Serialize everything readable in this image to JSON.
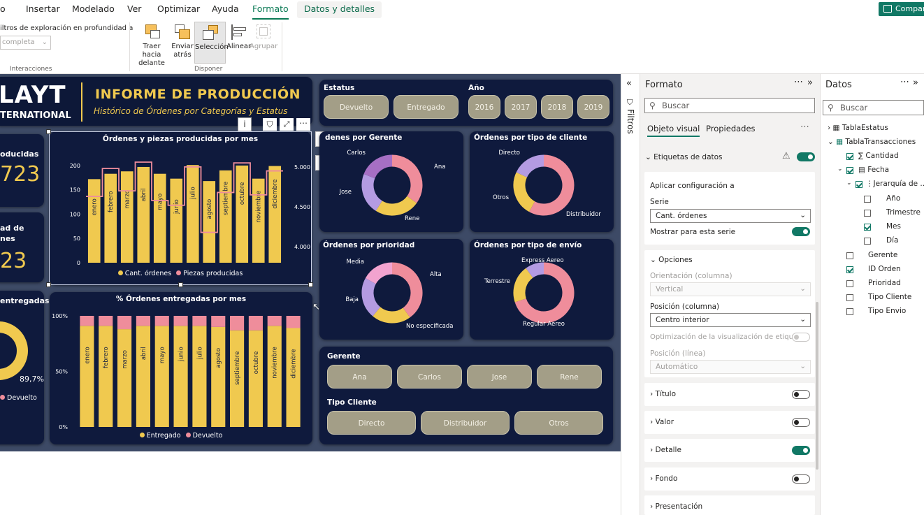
{
  "ribbon": {
    "tabs": [
      "o",
      "Insertar",
      "Modelado",
      "Ver",
      "Optimizar",
      "Ayuda",
      "Formato",
      "Datos y detalles"
    ],
    "share": "Compart",
    "drill_label": "iltros de exploración en profundidad a",
    "drill_value": "completa",
    "group_interacciones": "Interacciones",
    "group_disponer": "Disponer",
    "buttons": [
      "Traer hacia delante",
      "Enviar atrás",
      "Selección",
      "Alinear",
      "Agrupar"
    ]
  },
  "report": {
    "logo": "LAYT",
    "logo_sub": "TERNATIONAL",
    "title": "INFORME DE PRODUCCIÓN",
    "subtitle": "Histórico de Órdenes por Categorías y Estatus",
    "kpi1_label": "oducidas",
    "kpi1_value": "723",
    "kpi2_label": "ad de",
    "kpi2_label2": "nes",
    "kpi2_value": "23",
    "kpi3_label": "entregadas",
    "kpi3_value": "89,7%",
    "kpi3_legend": "Devuelto",
    "estatus_label": "Estatus",
    "estatus_options": [
      "Devuelto",
      "Entregado"
    ],
    "anio_label": "Año",
    "anio_options": [
      "2016",
      "2017",
      "2018",
      "2019"
    ],
    "gerente_label": "Gerente",
    "gerente_options": [
      "Ana",
      "Carlos",
      "Jose",
      "Rene"
    ],
    "tipo_cliente_label": "Tipo Cliente",
    "tipo_cliente_options": [
      "Directo",
      "Distribuidor",
      "Otros"
    ]
  },
  "charts": {
    "combo_title": "Órdenes y piezas producidas por mes",
    "combo_legend": [
      "Cant. órdenes",
      "Piezas producidas"
    ],
    "pct_title": "% Órdenes entregadas por mes",
    "pct_legend": [
      "Entregado",
      "Devuelto"
    ],
    "donut_gerente_title": "denes por Gerente",
    "donut_cliente_title": "Órdenes por tipo de cliente",
    "donut_prioridad_title": "Órdenes por prioridad",
    "donut_envio_title": "Órdenes por tipo de envío"
  },
  "chart_data": [
    {
      "type": "bar",
      "title": "Órdenes y piezas producidas por mes",
      "categories": [
        "enero",
        "febrero",
        "marzo",
        "abril",
        "mayo",
        "junio",
        "julio",
        "agosto",
        "septiembre",
        "octubre",
        "noviembre",
        "diciembre"
      ],
      "series": [
        {
          "name": "Cant. órdenes",
          "values": [
            172,
            183,
            188,
            197,
            183,
            173,
            201,
            168,
            190,
            200,
            173,
            199
          ]
        },
        {
          "name": "Piezas producidas",
          "values": [
            4630,
            4980,
            4700,
            5060,
            4580,
            4520,
            5000,
            4180,
            4680,
            5050,
            4650,
            4950
          ]
        }
      ],
      "yticks": [
        "0",
        "50",
        "100",
        "150",
        "200"
      ],
      "ylim": [
        0,
        230
      ],
      "y2ticks": [
        "4.000",
        "4.500",
        "5.000"
      ],
      "y2lim": [
        3800,
        5200
      ]
    },
    {
      "type": "bar",
      "title": "% Órdenes entregadas por mes",
      "categories": [
        "enero",
        "febrero",
        "marzo",
        "abril",
        "mayo",
        "junio",
        "julio",
        "agosto",
        "septiembre",
        "octubre",
        "noviembre",
        "diciembre"
      ],
      "series": [
        {
          "name": "Entregado",
          "values": [
            91,
            91,
            88,
            91,
            91,
            91,
            91,
            90,
            87,
            87,
            91,
            89
          ]
        },
        {
          "name": "Devuelto",
          "values": [
            9,
            9,
            12,
            9,
            9,
            9,
            9,
            10,
            13,
            13,
            9,
            11
          ]
        }
      ],
      "yticks": [
        "0%",
        "50%",
        "100%"
      ],
      "ylim": [
        0,
        100
      ]
    },
    {
      "type": "pie",
      "title": "denes por Gerente",
      "categories": [
        "Ana",
        "Rene",
        "Jose",
        "Carlos"
      ],
      "values": [
        35,
        24,
        22,
        19
      ],
      "colors": [
        "#ef8d9b",
        "#f0c94f",
        "#b49be2",
        "#a66fc4"
      ]
    },
    {
      "type": "pie",
      "title": "Órdenes por tipo de cliente",
      "categories": [
        "Distribuidor",
        "Otros",
        "Directo"
      ],
      "values": [
        58,
        24,
        18
      ],
      "colors": [
        "#ef8d9b",
        "#f0c94f",
        "#b49be2"
      ]
    },
    {
      "type": "pie",
      "title": "Órdenes por prioridad",
      "categories": [
        "Alta",
        "No especificada",
        "Baja",
        "Media"
      ],
      "values": [
        40,
        21,
        22,
        17
      ],
      "colors": [
        "#ef8d9b",
        "#f0c94f",
        "#b49be2",
        "#f2a3cf"
      ]
    },
    {
      "type": "pie",
      "title": "Órdenes por tipo de envío",
      "categories": [
        "Regular Aereo",
        "Terrestre",
        "Express Aereo"
      ],
      "values": [
        70,
        20,
        10
      ],
      "colors": [
        "#ef8d9b",
        "#f0c94f",
        "#b49be2"
      ]
    }
  ],
  "filters": {
    "label": "Filtros"
  },
  "format": {
    "title": "Formato",
    "search": "Buscar",
    "tabs": [
      "Objeto visual",
      "Propiedades"
    ],
    "etiquetas": "Etiquetas de datos",
    "aplicar": "Aplicar configuración a",
    "serie_label": "Serie",
    "serie_value": "Cant. órdenes",
    "mostrar": "Mostrar para esta serie",
    "opciones": "Opciones",
    "orient_label": "Orientación (columna)",
    "orient_value": "Vertical",
    "pos_label": "Posición (columna)",
    "pos_value": "Centro interior",
    "optim_label": "Optimización de la visualización de etiquetas",
    "posl_label": "Posición (línea)",
    "posl_value": "Automático",
    "sections": [
      "Título",
      "Valor",
      "Detalle",
      "Fondo",
      "Presentación"
    ]
  },
  "datos": {
    "title": "Datos",
    "search": "Buscar",
    "items": [
      "TablaEstatus",
      "TablaTransacciones",
      "Cantidad",
      "Fecha",
      "Jerarquía de ...",
      "Año",
      "Trimestre",
      "Mes",
      "Día",
      "Gerente",
      "ID Orden",
      "Prioridad",
      "Tipo Cliente",
      "Tipo Envio"
    ]
  },
  "colors": {
    "accent": "#117865",
    "gold": "#f0c94f",
    "pink": "#ef8d9b",
    "navy": "#0f1a3d",
    "slicer": "#a39e87"
  }
}
